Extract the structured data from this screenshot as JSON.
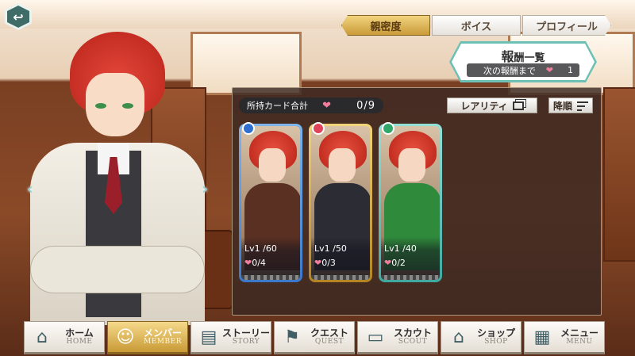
{
  "tabs": [
    {
      "label": "親密度"
    },
    {
      "label": "ボイス"
    },
    {
      "label": "プロフィール"
    }
  ],
  "rewards": {
    "title_big": "報",
    "title_rest": "酬一覧",
    "next_label": "次の報酬まで",
    "next_value": "1"
  },
  "owned_cards": {
    "label": "所持カード合計",
    "value": "0/9"
  },
  "sort": {
    "rarity_label": "レアリティ",
    "order_label": "降順"
  },
  "cards": [
    {
      "attr_color": "#2f6fd0",
      "level": "Lv1 /60",
      "affection": "0/4",
      "frame": "blue"
    },
    {
      "attr_color": "#e0445a",
      "level": "Lv1 /50",
      "affection": "0/3",
      "frame": "gold"
    },
    {
      "attr_color": "#2fa86a",
      "level": "Lv1 /40",
      "affection": "0/2",
      "frame": "teal"
    }
  ],
  "nav": [
    {
      "jp": "ホーム",
      "en": "HOME",
      "icon": "home-icon"
    },
    {
      "jp": "メンバー",
      "en": "MEMBER",
      "icon": "members-icon"
    },
    {
      "jp": "ストーリー",
      "en": "STORY",
      "icon": "book-icon"
    },
    {
      "jp": "クエスト",
      "en": "QUEST",
      "icon": "signpost-icon"
    },
    {
      "jp": "スカウト",
      "en": "SCOUT",
      "icon": "bus-icon"
    },
    {
      "jp": "ショップ",
      "en": "SHOP",
      "icon": "shop-icon"
    },
    {
      "jp": "メニュー",
      "en": "MENU",
      "icon": "grid-icon"
    }
  ],
  "colors": {
    "accent_gold": "#c99b39",
    "teal": "#6cc0b6",
    "heart": "#f27e9c"
  }
}
